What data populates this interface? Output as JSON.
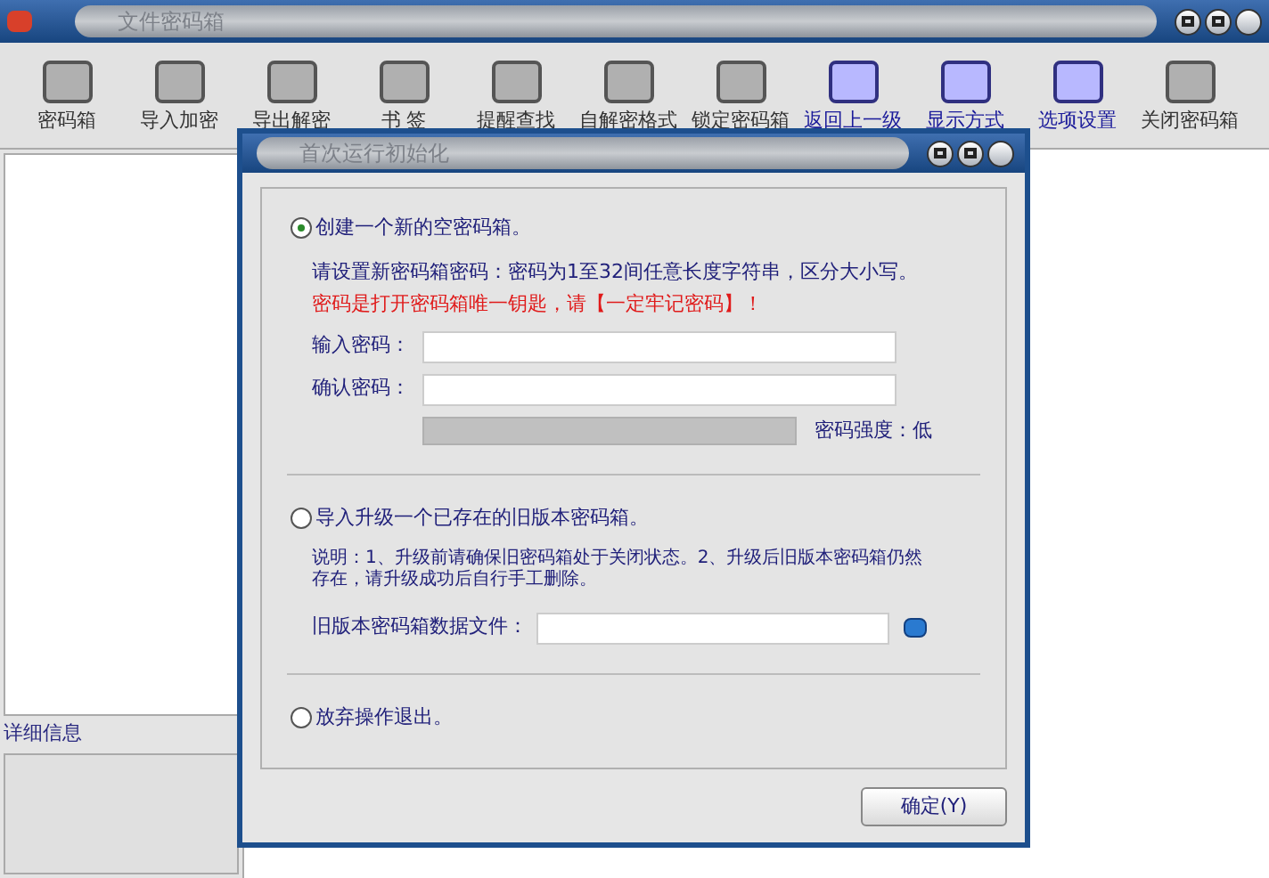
{
  "window": {
    "title": "文件密码箱"
  },
  "toolbar": [
    {
      "label": "密码箱",
      "highlighted": false
    },
    {
      "label": "导入加密",
      "highlighted": false
    },
    {
      "label": "导出解密",
      "highlighted": false
    },
    {
      "label": "书 签",
      "highlighted": false
    },
    {
      "label": "提醒查找",
      "highlighted": false
    },
    {
      "label": "自解密格式",
      "highlighted": false
    },
    {
      "label": "锁定密码箱",
      "highlighted": false
    },
    {
      "label": "返回上一级",
      "highlighted": true
    },
    {
      "label": "显示方式",
      "highlighted": true
    },
    {
      "label": "选项设置",
      "highlighted": true
    },
    {
      "label": "关闭密码箱",
      "highlighted": false
    }
  ],
  "details": {
    "title": "详细信息"
  },
  "dialog": {
    "title": "首次运行初始化",
    "options": [
      {
        "label": "创建一个新的空密码箱。",
        "selected": true
      },
      {
        "label": "导入升级一个已存在的旧版本密码箱。",
        "selected": false
      },
      {
        "label": "放弃操作退出。",
        "selected": false
      }
    ],
    "create_hint": "请设置新密码箱密码：密码为1至32间任意长度字符串，区分大小写。",
    "warning": "密码是打开密码箱唯一钥匙，请【一定牢记密码】！",
    "fields": [
      {
        "label": "输入密码："
      },
      {
        "label": "确认密码："
      }
    ],
    "strength": {
      "label": "密码强度：低"
    },
    "upgrade_note": "说明：1、升级前请确保旧密码箱处于关闭状态。2、升级后旧版本密码箱仍然存在，请升级成功后自行手工删除。",
    "file_field": {
      "label": "旧版本密码箱数据文件："
    },
    "ok_button": "确定(Y)"
  }
}
